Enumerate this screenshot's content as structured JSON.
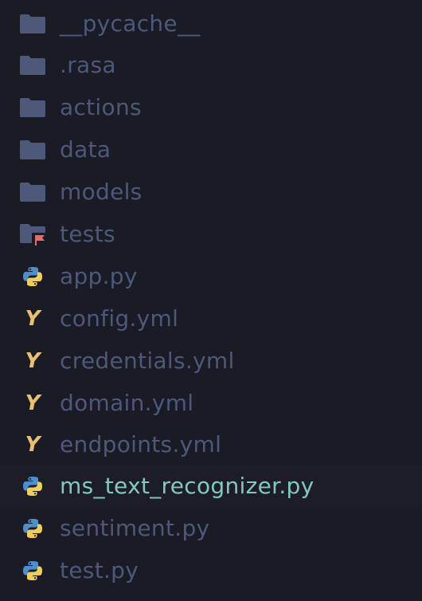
{
  "explorer": {
    "colors": {
      "folder": "#4e5879",
      "label": "#4e5879",
      "label_highlighted": "#82c8c0",
      "python_blue": "#4b8fd1",
      "python_yellow": "#f0ce5c",
      "yaml": "#e8c071",
      "flag": "#e86a6a",
      "background": "#1a1b24"
    },
    "items": [
      {
        "label": "__pycache__",
        "icon": "folder-icon"
      },
      {
        "label": ".rasa",
        "icon": "folder-icon"
      },
      {
        "label": "actions",
        "icon": "folder-icon"
      },
      {
        "label": "data",
        "icon": "folder-icon"
      },
      {
        "label": "models",
        "icon": "folder-icon"
      },
      {
        "label": "tests",
        "icon": "test-folder-icon"
      },
      {
        "label": "app.py",
        "icon": "python-icon"
      },
      {
        "label": "config.yml",
        "icon": "yaml-icon",
        "glyph": "Y"
      },
      {
        "label": "credentials.yml",
        "icon": "yaml-icon",
        "glyph": "Y"
      },
      {
        "label": "domain.yml",
        "icon": "yaml-icon",
        "glyph": "Y"
      },
      {
        "label": "endpoints.yml",
        "icon": "yaml-icon",
        "glyph": "Y"
      },
      {
        "label": "ms_text_recognizer.py",
        "icon": "python-icon",
        "highlighted": true
      },
      {
        "label": "sentiment.py",
        "icon": "python-icon"
      },
      {
        "label": "test.py",
        "icon": "python-icon"
      }
    ]
  }
}
